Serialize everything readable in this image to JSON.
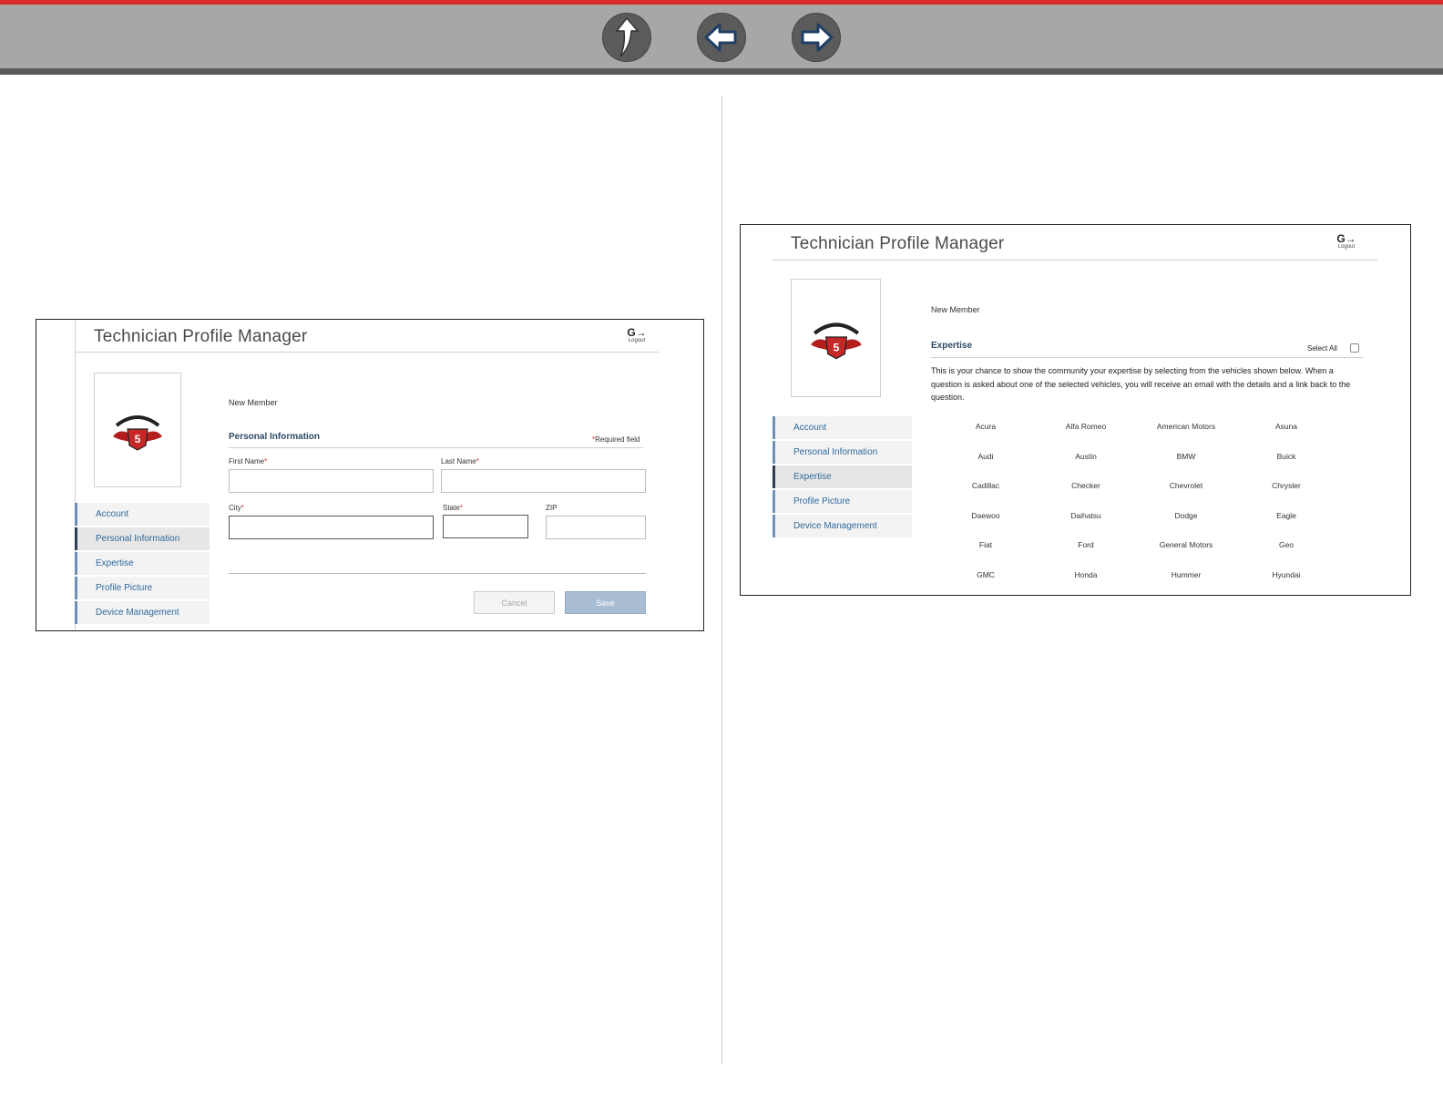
{
  "nav": {
    "up_icon": "up-arrow-icon",
    "back_icon": "left-arrow-icon",
    "forward_icon": "right-arrow-icon"
  },
  "left_screenshot": {
    "title": "Technician Profile Manager",
    "logout_label": "Logout",
    "member_status": "New Member",
    "sidebar": [
      {
        "label": "Account",
        "active": false
      },
      {
        "label": "Personal Information",
        "active": true
      },
      {
        "label": "Expertise",
        "active": false
      },
      {
        "label": "Profile Picture",
        "active": false
      },
      {
        "label": "Device Management",
        "active": false
      }
    ],
    "section_title": "Personal Information",
    "required_note": "Required field",
    "fields": {
      "first_name": {
        "label": "First Name",
        "value": ""
      },
      "last_name": {
        "label": "Last Name",
        "value": ""
      },
      "city": {
        "label": "City",
        "value": ""
      },
      "state": {
        "label": "State",
        "value": ""
      },
      "zip": {
        "label": "ZIP",
        "value": ""
      }
    },
    "cancel_label": "Cancel",
    "save_label": "Save"
  },
  "right_screenshot": {
    "title": "Technician Profile Manager",
    "logout_label": "Logout",
    "member_status": "New Member",
    "sidebar": [
      {
        "label": "Account",
        "active": false
      },
      {
        "label": "Personal Information",
        "active": false
      },
      {
        "label": "Expertise",
        "active": true
      },
      {
        "label": "Profile Picture",
        "active": false
      },
      {
        "label": "Device Management",
        "active": false
      }
    ],
    "section_title": "Expertise",
    "select_all_label": "Select All",
    "description": "This is your chance to show the community your expertise by selecting from the vehicles shown below. When a question is asked about one of the selected vehicles, you will receive an email with the details and a link back to the question.",
    "vehicles": [
      "Acura",
      "Alfa Romeo",
      "American Motors",
      "Asuna",
      "Audi",
      "Austin",
      "BMW",
      "Buick",
      "Cadillac",
      "Checker",
      "Chevrolet",
      "Chrysler",
      "Daewoo",
      "Daihatsu",
      "Dodge",
      "Eagle",
      "Fiat",
      "Ford",
      "General Motors",
      "Geo",
      "GMC",
      "Honda",
      "Hummer",
      "Hyundai"
    ]
  },
  "colors": {
    "accent_red": "#d92a2a",
    "nav_bar": "#a7a7a7",
    "link_blue": "#2f6a9d",
    "save_button": "#a8bcd2"
  }
}
